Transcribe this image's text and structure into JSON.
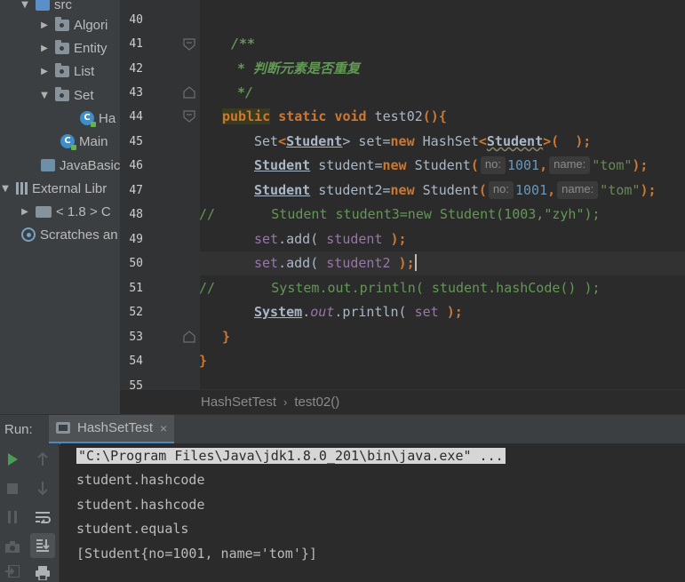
{
  "sidebar": {
    "items": [
      {
        "label": "src",
        "icon": "source-folder-icon",
        "arrow": "▼"
      },
      {
        "label": "Algori",
        "icon": "package-folder-icon",
        "arrow": "▶"
      },
      {
        "label": "Entity",
        "icon": "package-folder-icon",
        "arrow": "▶"
      },
      {
        "label": "List",
        "icon": "package-folder-icon",
        "arrow": "▶"
      },
      {
        "label": "Set",
        "icon": "package-folder-icon",
        "arrow": "▼"
      },
      {
        "label": "Ha",
        "icon": "java-class-icon",
        "arrow": ""
      },
      {
        "label": "Main",
        "icon": "java-class-icon",
        "arrow": ""
      },
      {
        "label": "JavaBasic",
        "icon": "module-file-icon",
        "arrow": ""
      },
      {
        "label": "External Libr",
        "icon": "library-icon",
        "arrow": "▼"
      },
      {
        "label": "< 1.8 >  C",
        "icon": "sdk-folder-icon",
        "arrow": "▶"
      },
      {
        "label": "Scratches an",
        "icon": "scratches-icon",
        "arrow": ""
      }
    ]
  },
  "editor": {
    "line_numbers": [
      "40",
      "41",
      "42",
      "43",
      "44",
      "45",
      "46",
      "47",
      "48",
      "49",
      "50",
      "51",
      "52",
      "53",
      "54",
      "55"
    ],
    "lines": {
      "l41": "/**",
      "l42": "* 判断元素是否重复",
      "l43": "*/",
      "l44": {
        "kw1": "public",
        "kw2": "static",
        "kw3": "void",
        "name": "test02",
        "tail": "(){"
      },
      "l45": {
        "a": "Set",
        "b": "<",
        "c": "Student",
        "d": "> set=",
        "e": "new",
        "f": " HashSet",
        "g": "<",
        "h": "Student",
        "i": ">(  );"
      },
      "l46": {
        "t": "Student",
        "v": " student=",
        "n": "new",
        "c": " Student",
        "o": "(",
        "h1": "no:",
        "n1": "1001",
        "comma": ",",
        "h2": "name:",
        "s": "\"tom\"",
        "e": ");"
      },
      "l47": {
        "t": "Student",
        "v": " student2=",
        "n": "new",
        "c": " Student",
        "o": "(",
        "h1": "no:",
        "n1": "1001",
        "comma": ",",
        "h2": "name:",
        "s": "\"tom\"",
        "e": ");"
      },
      "l48": "//       Student student3=new Student(1003,\"zyh\");",
      "l49": {
        "a": "set",
        "b": ".add( ",
        "c": "student",
        "d": " );"
      },
      "l50": {
        "a": "set",
        "b": ".add( ",
        "c": "student2",
        "d": " )",
        "e": ";"
      },
      "l51": "//       System.out.println( student.hashCode() );",
      "l52": {
        "a": "System",
        "b": ".",
        "c": "out",
        "d": ".println( ",
        "e": "set",
        "f": " );"
      },
      "l53": "}",
      "l54": "}"
    }
  },
  "breadcrumb": {
    "file": "HashSetTest",
    "separator": "›",
    "method": "test02()"
  },
  "run_panel": {
    "label": "Run:",
    "tab_label": "HashSetTest",
    "tab_close": "×",
    "output": [
      "\"C:\\Program Files\\Java\\jdk1.8.0_201\\bin\\java.exe\" ...",
      "student.hashcode",
      "student.hashcode",
      "student.equals",
      "[Student{no=1001, name='tom'}]"
    ]
  },
  "colors": {
    "editor_bg": "#2b2b2b",
    "gutter_bg": "#313335",
    "panel_bg": "#3c3f41",
    "keyword": "#cc7832",
    "number": "#6897bb",
    "string": "#6a8759",
    "comment": "#629755",
    "field": "#9876aa",
    "run_green": "#499c54"
  }
}
